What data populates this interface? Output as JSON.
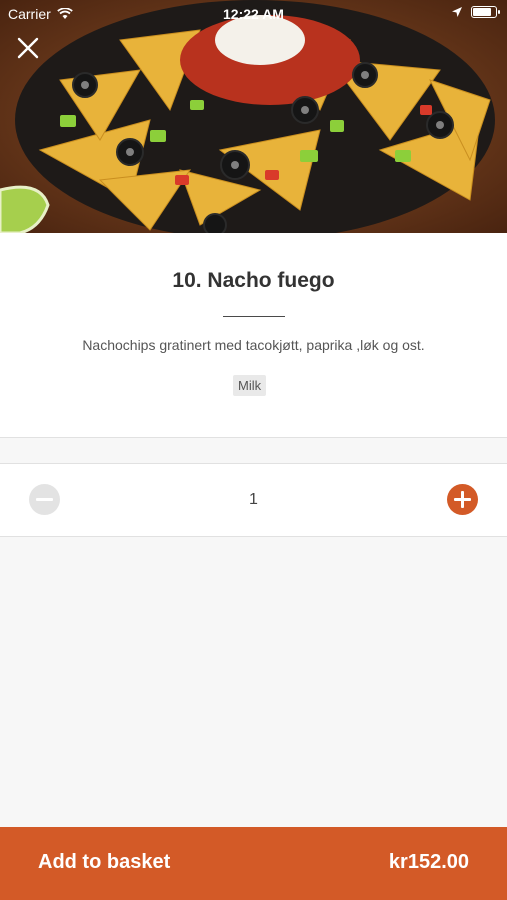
{
  "status_bar": {
    "carrier": "Carrier",
    "time": "12:22 AM",
    "battery_level": 0.9
  },
  "hero": {
    "image_icon": "nachos-photo"
  },
  "product": {
    "title": "10. Nacho fuego",
    "description": "Nachochips gratinert med tacokjøtt, paprika ,løk og ost.",
    "allergen_tag": "Milk"
  },
  "quantity": {
    "value": "1"
  },
  "basket": {
    "label": "Add to basket",
    "price": "kr152.00"
  },
  "colors": {
    "accent": "#d35a27",
    "minus_disabled": "#e3e3e3"
  }
}
